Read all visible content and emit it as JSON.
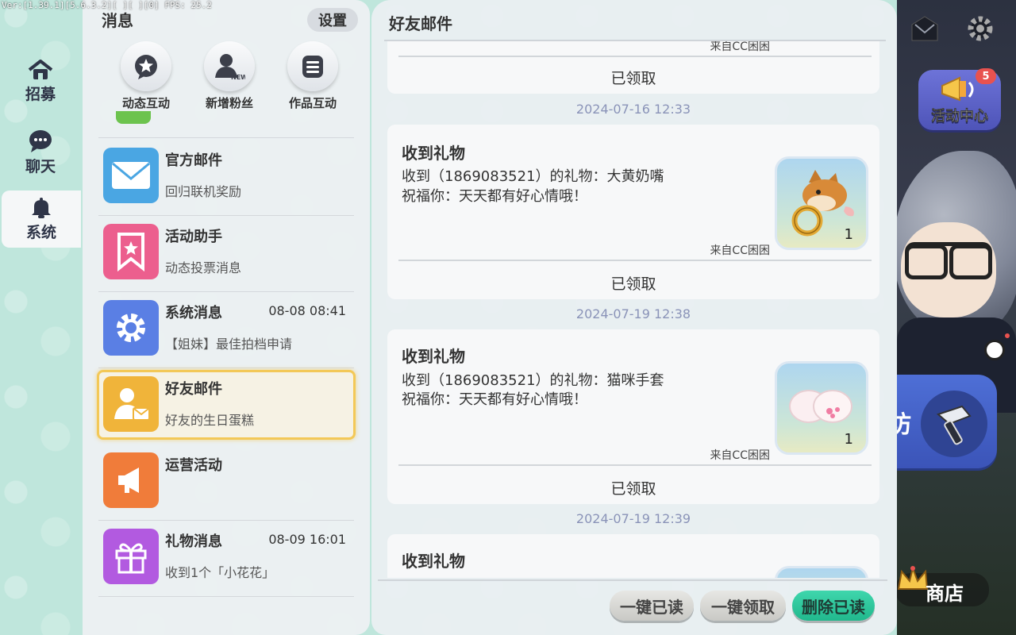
{
  "debug": {
    "text": "Ver:[1.39.1][5.6.3.2][  ][     ][0] FPS: 25.2"
  },
  "left_tabs": [
    {
      "label": "招募",
      "icon": "house-icon"
    },
    {
      "label": "聊天",
      "icon": "chat-bubble-icon"
    },
    {
      "label": "系统",
      "icon": "bell-icon",
      "active": true
    }
  ],
  "messages": {
    "title": "消息",
    "settings_label": "设置",
    "quick": [
      {
        "label": "动态互动",
        "icon": "star-chat-icon"
      },
      {
        "label": "新增粉丝",
        "icon": "new-fan-icon",
        "badge": "NEW"
      },
      {
        "label": "作品互动",
        "icon": "document-list-icon"
      }
    ],
    "items": [
      {
        "title": "官方邮件",
        "subtitle": "回归联机奖励",
        "time": "",
        "icon": "envelope-icon",
        "color": "#4aa6e3"
      },
      {
        "title": "活动助手",
        "subtitle": "动态投票消息",
        "time": "",
        "icon": "bookmark-star-icon",
        "color": "#ec5f8e"
      },
      {
        "title": "系统消息",
        "subtitle": "【姐妹】最佳拍档申请",
        "time": "08-08 08:41",
        "icon": "gear-icon",
        "color": "#5a7fe4"
      },
      {
        "title": "好友邮件",
        "subtitle": "好友的生日蛋糕",
        "time": "",
        "icon": "friend-mail-icon",
        "color": "#f0b43a",
        "selected": true
      },
      {
        "title": "运营活动",
        "subtitle": "",
        "time": "",
        "icon": "megaphone-icon",
        "color": "#f07c3a"
      },
      {
        "title": "礼物消息",
        "subtitle": "收到1个「小花花」",
        "time": "08-09 16:01",
        "icon": "gift-icon",
        "color": "#b25ae0"
      }
    ]
  },
  "mail": {
    "title": "好友邮件",
    "partial_top": {
      "from": "来自CC困困",
      "status": "已领取"
    },
    "entries": [
      {
        "date": "2024-07-16 12:33",
        "title": "收到礼物",
        "line1": "收到（1869083521）的礼物：大黄奶嘴",
        "line2": "祝福你：天天都有好心情哦！",
        "count": "1",
        "from": "来自CC困困",
        "status": "已领取",
        "item": "dog-pacifier"
      },
      {
        "date": "2024-07-19 12:38",
        "title": "收到礼物",
        "line1": "收到（1869083521）的礼物：猫咪手套",
        "line2": "祝福你：天天都有好心情哦！",
        "count": "1",
        "from": "来自CC困困",
        "status": "已领取",
        "item": "cat-paw-gloves"
      },
      {
        "date": "2024-07-19 12:39",
        "title": "收到礼物"
      }
    ],
    "actions": {
      "read_all": "一键已读",
      "claim_all": "一键领取",
      "delete_read": "删除已读"
    }
  },
  "game_hud": {
    "activity_center": "活动中心",
    "activity_badge": "5",
    "build_partial": "坊",
    "shop": "商店"
  },
  "colors": {
    "accent_green": "#21b88d",
    "selected_border": "#f3c857",
    "date_text": "#8a93b8"
  }
}
